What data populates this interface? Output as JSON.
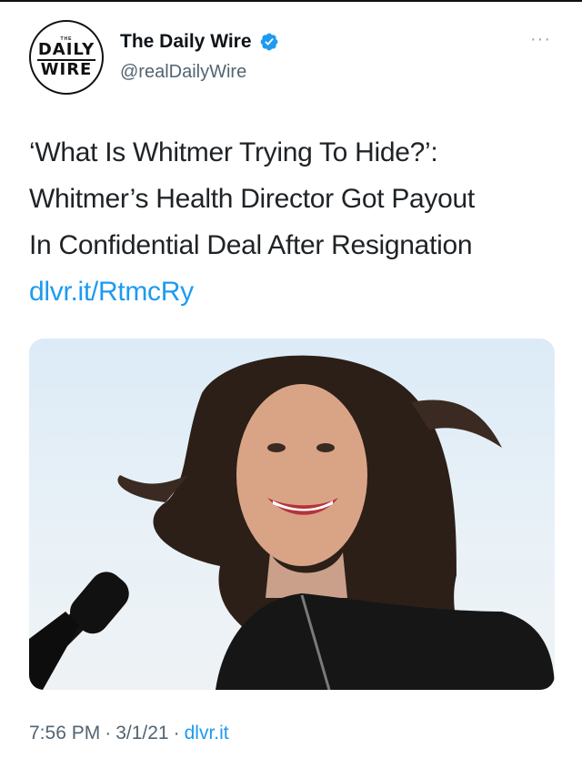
{
  "account": {
    "avatar_logo": {
      "small_text": "THE",
      "line1": "DAILY",
      "line2": "WIRE"
    },
    "display_name": "The Daily Wire",
    "handle": "@realDailyWire",
    "verified": true
  },
  "menu": {
    "more_label": "···"
  },
  "tweet": {
    "text_lines": [
      "‘What Is Whitmer Trying To Hide?’:",
      "Whitmer’s Health Director Got Payout",
      "In Confidential Deal After Resignation"
    ],
    "link_text": "dlvr.it/RtmcRy"
  },
  "media": {
    "description_icon": "photo"
  },
  "footer": {
    "time": "7:56 PM",
    "separator": "·",
    "date": "3/1/21",
    "source": "dlvr.it"
  },
  "colors": {
    "link": "#1d9bf0",
    "secondary_text": "#536471",
    "verified_badge": "#1d9bf0"
  }
}
